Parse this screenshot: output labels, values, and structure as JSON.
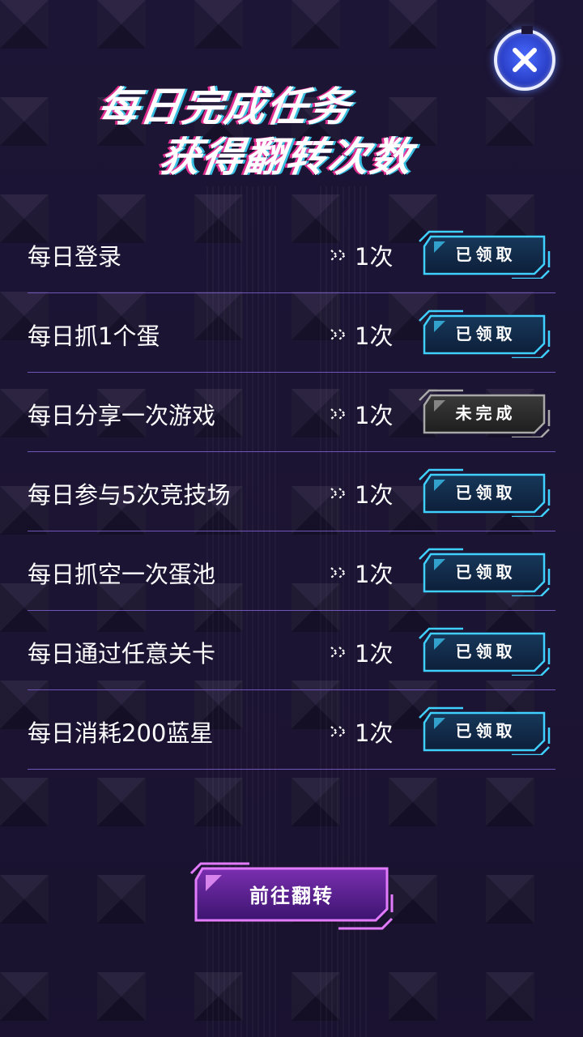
{
  "title": {
    "line1": "每日完成任务",
    "line2": "获得翻转次数"
  },
  "close_icon": "close-x-icon",
  "tasks": [
    {
      "name": "每日登录",
      "reward": "1次",
      "status": "已领取",
      "state": "claimed"
    },
    {
      "name": "每日抓1个蛋",
      "reward": "1次",
      "status": "已领取",
      "state": "claimed"
    },
    {
      "name": "每日分享一次游戏",
      "reward": "1次",
      "status": "未完成",
      "state": "incomplete"
    },
    {
      "name": "每日参与5次竞技场",
      "reward": "1次",
      "status": "已领取",
      "state": "claimed"
    },
    {
      "name": "每日抓空一次蛋池",
      "reward": "1次",
      "status": "已领取",
      "state": "claimed"
    },
    {
      "name": "每日通过任意关卡",
      "reward": "1次",
      "status": "已领取",
      "state": "claimed"
    },
    {
      "name": "每日消耗200蓝星",
      "reward": "1次",
      "status": "已领取",
      "state": "claimed"
    }
  ],
  "go_button": {
    "label": "前往翻转"
  },
  "colors": {
    "background": "#1d1535",
    "divider": "#6f55b8",
    "claimed_border": "#3fd0ff",
    "incomplete_border": "#9a9a9a",
    "go_border": "#d65cff",
    "title_glitch_pink": "#ff32a0",
    "title_glitch_cyan": "#3cdcff"
  }
}
